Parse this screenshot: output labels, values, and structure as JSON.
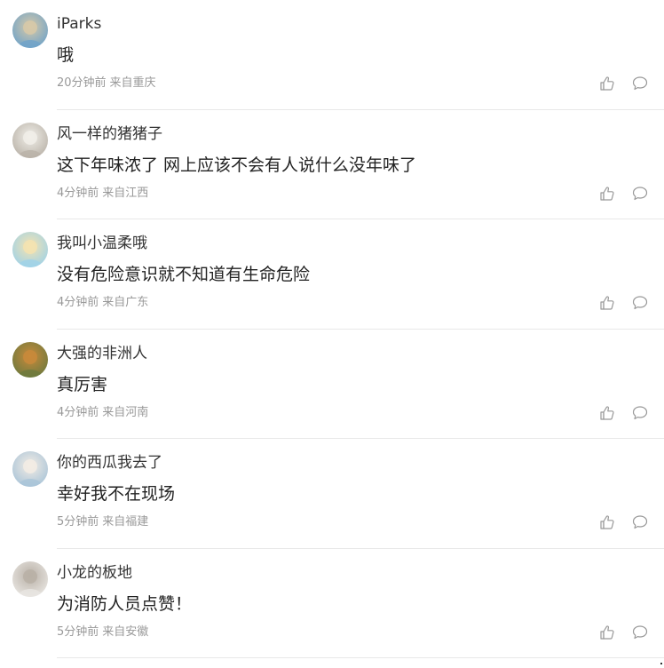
{
  "comments": [
    {
      "username": "iParks",
      "content": "哦",
      "time": "20分钟前",
      "location": "来自重庆",
      "avatar_icon": "avatar-landscape-icon",
      "avatar_colors": [
        "#6fa3c9",
        "#d8c9a8"
      ]
    },
    {
      "username": "风一样的猪猪子",
      "content": "这下年味浓了 网上应该不会有人说什么没年味了",
      "time": "4分钟前",
      "location": "来自江西",
      "avatar_icon": "avatar-cat-icon",
      "avatar_colors": [
        "#b9b2a8",
        "#f1efe9"
      ]
    },
    {
      "username": "我叫小温柔哦",
      "content": "没有危险意识就不知道有生命危险",
      "time": "4分钟前",
      "location": "来自广东",
      "avatar_icon": "avatar-anime-girl-icon",
      "avatar_colors": [
        "#9fd2e8",
        "#f5e3b0"
      ]
    },
    {
      "username": "大强的非洲人",
      "content": "真厉害",
      "time": "4分钟前",
      "location": "来自河南",
      "avatar_icon": "avatar-tiger-icon",
      "avatar_colors": [
        "#6d7a3e",
        "#c98a3b"
      ]
    },
    {
      "username": "你的西瓜我去了",
      "content": "幸好我不在现场",
      "time": "5分钟前",
      "location": "来自福建",
      "avatar_icon": "avatar-girl-icon",
      "avatar_colors": [
        "#a9c4d8",
        "#f3ece4"
      ]
    },
    {
      "username": "小龙的板地",
      "content": "为消防人员点赞！",
      "time": "5分钟前",
      "location": "来自安徽",
      "avatar_icon": "avatar-sketch-icon",
      "avatar_colors": [
        "#e9e6e2",
        "#b8b0a6"
      ]
    }
  ],
  "actions": {
    "like_icon": "thumbs-up-icon",
    "reply_icon": "speech-bubble-icon"
  },
  "colors": {
    "text_primary": "#222222",
    "text_meta": "#999999",
    "divider": "#e8e8e8",
    "icon": "#999999"
  }
}
